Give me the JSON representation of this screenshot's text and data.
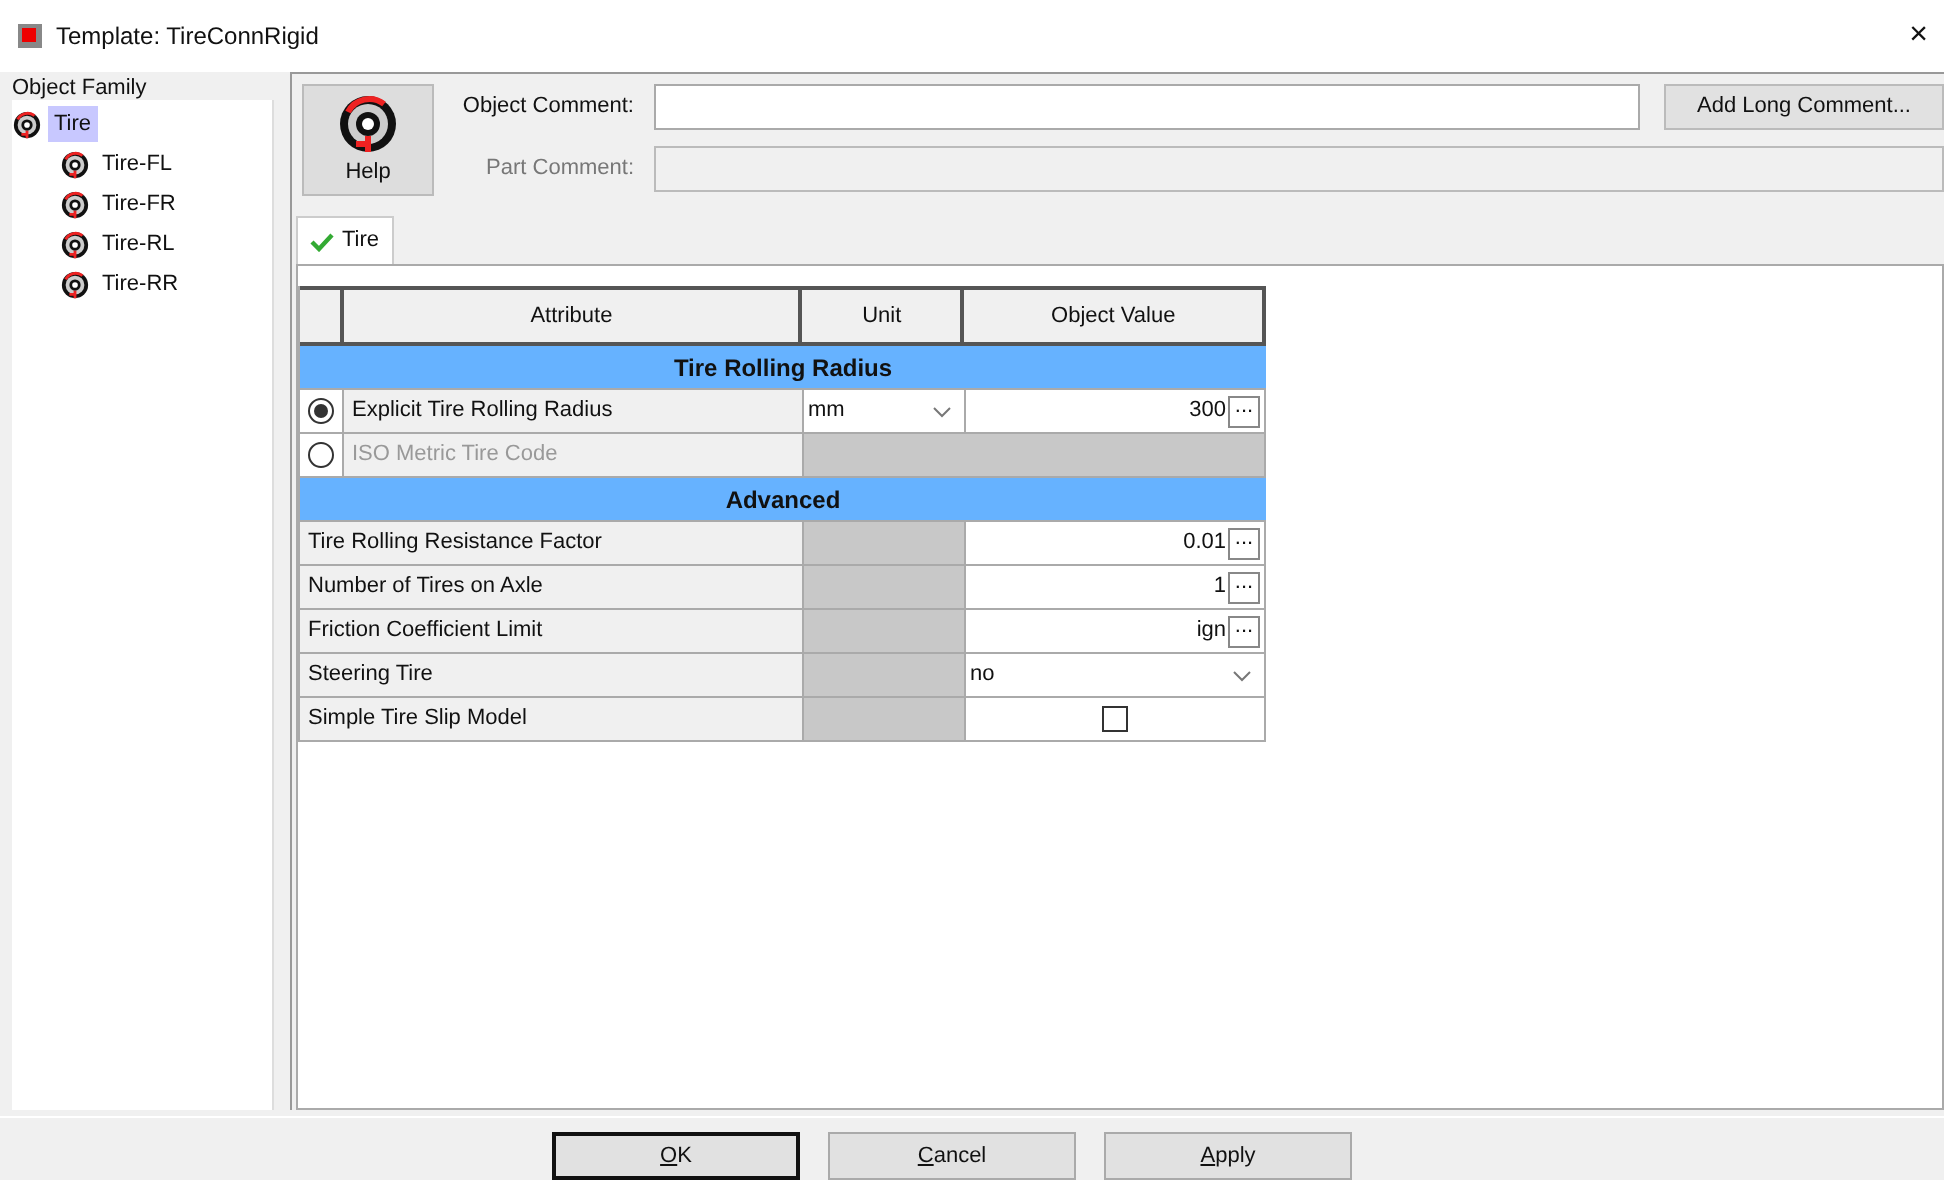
{
  "window": {
    "title": "Template: TireConnRigid",
    "close": "×"
  },
  "object_family": {
    "label": "Object Family",
    "tree": [
      {
        "label": "Tire",
        "selected": true,
        "children": [
          {
            "label": "Tire-FL",
            "selected": false
          },
          {
            "label": "Tire-FR",
            "selected": false
          },
          {
            "label": "Tire-RL",
            "selected": false
          },
          {
            "label": "Tire-RR",
            "selected": false
          }
        ]
      }
    ]
  },
  "help_button": "Help",
  "object_comment": {
    "label": "Object Comment:"
  },
  "add_long_comment": "Add Long Comment...",
  "part_comment": {
    "label": "Part Comment:",
    "disabled": true
  },
  "tabs": [
    {
      "label": "Tire",
      "selected": true
    }
  ],
  "table": {
    "columns": [
      "Attribute",
      "Unit",
      "Object Value"
    ],
    "rows": [
      {
        "kind": "section",
        "label": "Tire Rolling Radius"
      },
      {
        "kind": "radio",
        "label": "Explicit Tire Rolling Radius",
        "selected": true,
        "disabled": false,
        "unit": "mm",
        "value": "300",
        "button": "..."
      },
      {
        "kind": "radio",
        "label": "ISO Metric Tire Code",
        "selected": false,
        "disabled": true
      },
      {
        "kind": "section",
        "label": "Advanced"
      },
      {
        "kind": "value",
        "label": "Tire Rolling Resistance Factor",
        "value": "0.01",
        "button": "..."
      },
      {
        "kind": "value",
        "label": "Number of Tires on Axle",
        "value": "1",
        "button": "..."
      },
      {
        "kind": "value",
        "label": "Friction Coefficient Limit",
        "value": "ign",
        "button": "..."
      },
      {
        "kind": "combo",
        "label": "Steering Tire",
        "value": "no"
      },
      {
        "kind": "checkbox",
        "label": "Simple Tire Slip Model",
        "checked": false
      }
    ]
  },
  "buttons": [
    "OK",
    "Cancel",
    "Apply"
  ]
}
